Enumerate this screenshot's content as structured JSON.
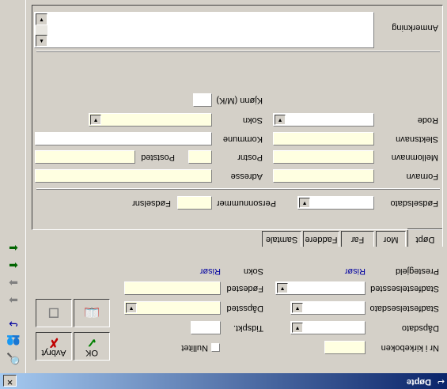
{
  "window": {
    "title": "Døpte",
    "close_glyph": "✕",
    "app_glyph": "↩"
  },
  "top": {
    "nr_label": "Nr i kirkeboken",
    "nullitet_label": "Nullitet",
    "dapsdato_label": "Dåpsdato",
    "tidspkt_label": "Tidspkt.",
    "daapssted_label": "Dåpssted",
    "stadfestelsesdato_label": "Stadfestelsesdato",
    "stadfestelsessted_label": "Stadfestelsessted",
    "fodested_label": "Fødested",
    "prestegjeld_label": "Prestegjeld",
    "prestegjeld_value": "Risør",
    "sokn_label": "Sokn",
    "sokn_value": "Risør"
  },
  "buttons": {
    "ok_label": "OK",
    "avbryt_label": "Avbryt",
    "ok_glyph": "✓",
    "avbryt_glyph": "✗",
    "book_glyph": "📖",
    "blank_glyph": "☐"
  },
  "tabs": [
    "Døpt",
    "Mor",
    "Far",
    "Faddere",
    "Samtale"
  ],
  "form": {
    "fodselsdato_label": "Fødselsdato",
    "personnummer_label": "Personnummer",
    "fodselsnr_label": "Fødselsnr",
    "fornavn_label": "Fornavn",
    "adresse_label": "Adresse",
    "mellomnavn_label": "Mellomnavn",
    "postnr_label": "Postnr",
    "poststed_label": "Poststed",
    "slektsnavn_label": "Slektsnavn",
    "kommune_label": "Kommune",
    "rode_label": "Rode",
    "sokn_label": "Sokn",
    "kjonn_label": "Kjønn (M/K)",
    "anmerkning_label": "Anmerkning"
  },
  "sidebar": {
    "icons": [
      "🔍",
      "👥",
      "↪",
      "➡",
      "➡",
      "⬅",
      "⬅"
    ]
  },
  "colors": {
    "face": "#d4d0c8",
    "field_yellow": "#ffffe1",
    "link_blue": "#0000a0",
    "title_dark": "#0a246a"
  }
}
